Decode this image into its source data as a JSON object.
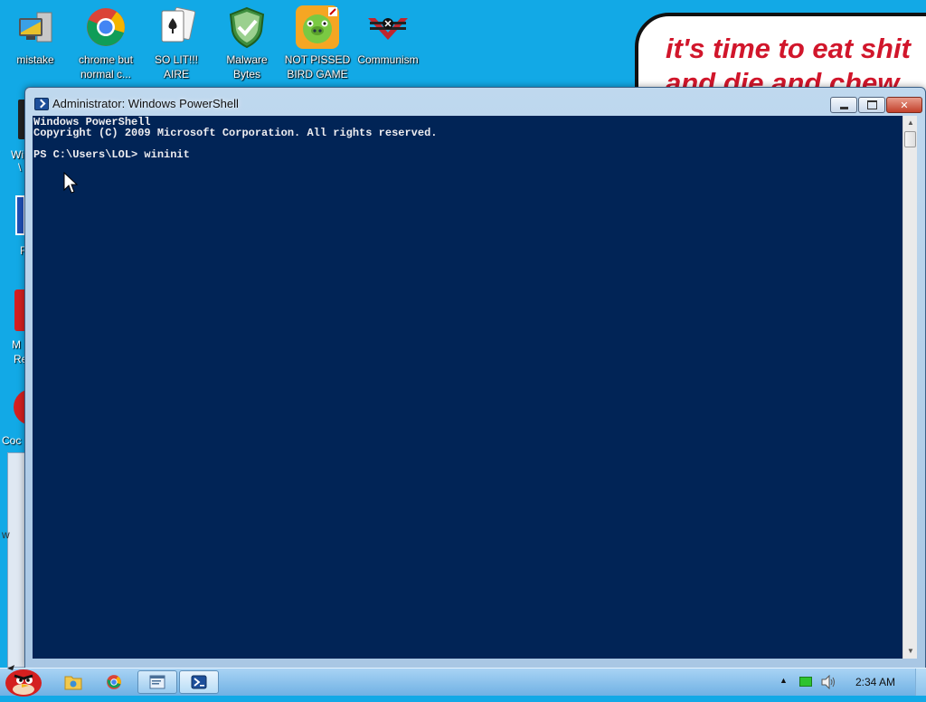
{
  "desktop": {
    "icons": [
      {
        "label1": "mistake",
        "label2": ""
      },
      {
        "label1": "chrome but",
        "label2": "normal c..."
      },
      {
        "label1": "SO LIT!!!",
        "label2": "AIRE"
      },
      {
        "label1": "Malware",
        "label2": "Bytes"
      },
      {
        "label1": "NOT PISSED",
        "label2": "BIRD GAME"
      },
      {
        "label1": "Communism",
        "label2": ""
      }
    ],
    "edge_labels": {
      "win": "Wi",
      "f": "F",
      "m": "M",
      "re": "Re",
      "coc": "Coc",
      "w": "w"
    },
    "sign": {
      "line1": "it's time to eat shit",
      "line2": "and die and chew"
    }
  },
  "window": {
    "title": "Administrator: Windows PowerShell",
    "console_lines": [
      "Windows PowerShell",
      "Copyright (C) 2009 Microsoft Corporation. All rights reserved.",
      "",
      "PS C:\\Users\\LOL> wininit"
    ]
  },
  "taskbar": {
    "clock": "2:34 AM"
  },
  "colors": {
    "desktop_bg": "#12a9e6",
    "console_bg": "#012456",
    "console_text": "#eeedf0",
    "sign_text": "#d1162b"
  }
}
